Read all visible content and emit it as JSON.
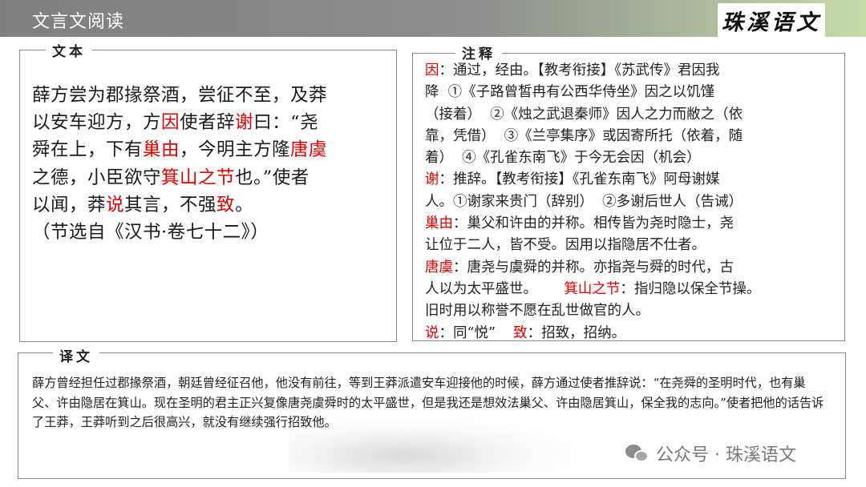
{
  "header": {
    "title": "文言文阅读",
    "brand": "珠溪语文"
  },
  "text_section": {
    "label": "文本",
    "lines": [
      [
        {
          "t": "薛方尝为郡掾祭酒，尝征不至，及莽"
        }
      ],
      [
        {
          "t": "以安车迎方，方"
        },
        {
          "t": "因",
          "r": true
        },
        {
          "t": "使者辞"
        },
        {
          "t": "谢",
          "r": true
        },
        {
          "t": "曰：“尧"
        }
      ],
      [
        {
          "t": "舜在上，下有"
        },
        {
          "t": "巢由",
          "r": true
        },
        {
          "t": "，今明主方隆"
        },
        {
          "t": "唐虞",
          "r": true
        }
      ],
      [
        {
          "t": "之德，小臣欲守"
        },
        {
          "t": "箕山之节",
          "r": true
        },
        {
          "t": "也。”使者"
        }
      ],
      [
        {
          "t": "以闻，莽"
        },
        {
          "t": "说",
          "r": true
        },
        {
          "t": "其言，不强"
        },
        {
          "t": "致",
          "r": true
        },
        {
          "t": "。"
        }
      ],
      [
        {
          "t": "（节选自《汉书·卷七十二》）"
        }
      ]
    ]
  },
  "notes_section": {
    "label": "注释",
    "lines": [
      [
        {
          "t": "因",
          "r": true
        },
        {
          "t": "：通过，经由。【教考衔接】《苏武传》君因我"
        }
      ],
      [
        {
          "t": "降  ①《子路曾皙冉有公西华侍坐》因之以饥馑"
        }
      ],
      [
        {
          "t": "（接着）  ②《烛之武退秦师》因人之力而敝之（依"
        }
      ],
      [
        {
          "t": "靠，凭借）  ③《兰亭集序》或因寄所托（依着，随"
        }
      ],
      [
        {
          "t": "着）  ④《孔雀东南飞》于今无会因（机会）"
        }
      ],
      [
        {
          "t": "谢",
          "r": true
        },
        {
          "t": "：推辞。【教考衔接】《孔雀东南飞》阿母谢媒"
        }
      ],
      [
        {
          "t": "人。①谢家来贵门（辞别）  ②多谢后世人（告诫）"
        }
      ],
      [
        {
          "t": "巢由",
          "r": true
        },
        {
          "t": "：巢父和许由的并称。相传皆为尧时隐士，尧"
        }
      ],
      [
        {
          "t": "让位于二人，皆不受。因用以指隐居不仕者。"
        }
      ],
      [
        {
          "t": "唐虞",
          "r": true
        },
        {
          "t": "：唐尧与虞舜的并称。亦指尧与舜的时代，古"
        }
      ],
      [
        {
          "t": "人以为太平盛世。      "
        },
        {
          "t": "箕山之节",
          "r": true
        },
        {
          "t": "：指归隐以保全节操。"
        }
      ],
      [
        {
          "t": "旧时用以称誉不愿在乱世做官的人。"
        }
      ],
      [
        {
          "t": "说",
          "r": true
        },
        {
          "t": "：同“悦”    "
        },
        {
          "t": "致",
          "r": true
        },
        {
          "t": "：招致，招纳。"
        }
      ]
    ]
  },
  "translation_section": {
    "label": "译文",
    "text": "薛方曾经担任过郡掾祭酒，朝廷曾经征召他，他没有前往，等到王莽派遣安车迎接他的时候，薛方通过使者推辞说：“在尧舜的圣明时代，也有巢父、许由隐居在箕山。现在圣明的君主正兴复像唐尧虞舜时的太平盛世，但是我还是想效法巢父、许由隐居箕山，保全我的志向。”使者把他的话告诉了王莽，王莽听到之后很高兴，就没有继续强行招致他。"
  },
  "watermark": {
    "text": "公众号 · 珠溪语文",
    "icon": "wechat-icon"
  },
  "colors": {
    "highlight": "#e00000",
    "header_bg": "#8c8c8c",
    "header_accent": "#c7dba8"
  }
}
